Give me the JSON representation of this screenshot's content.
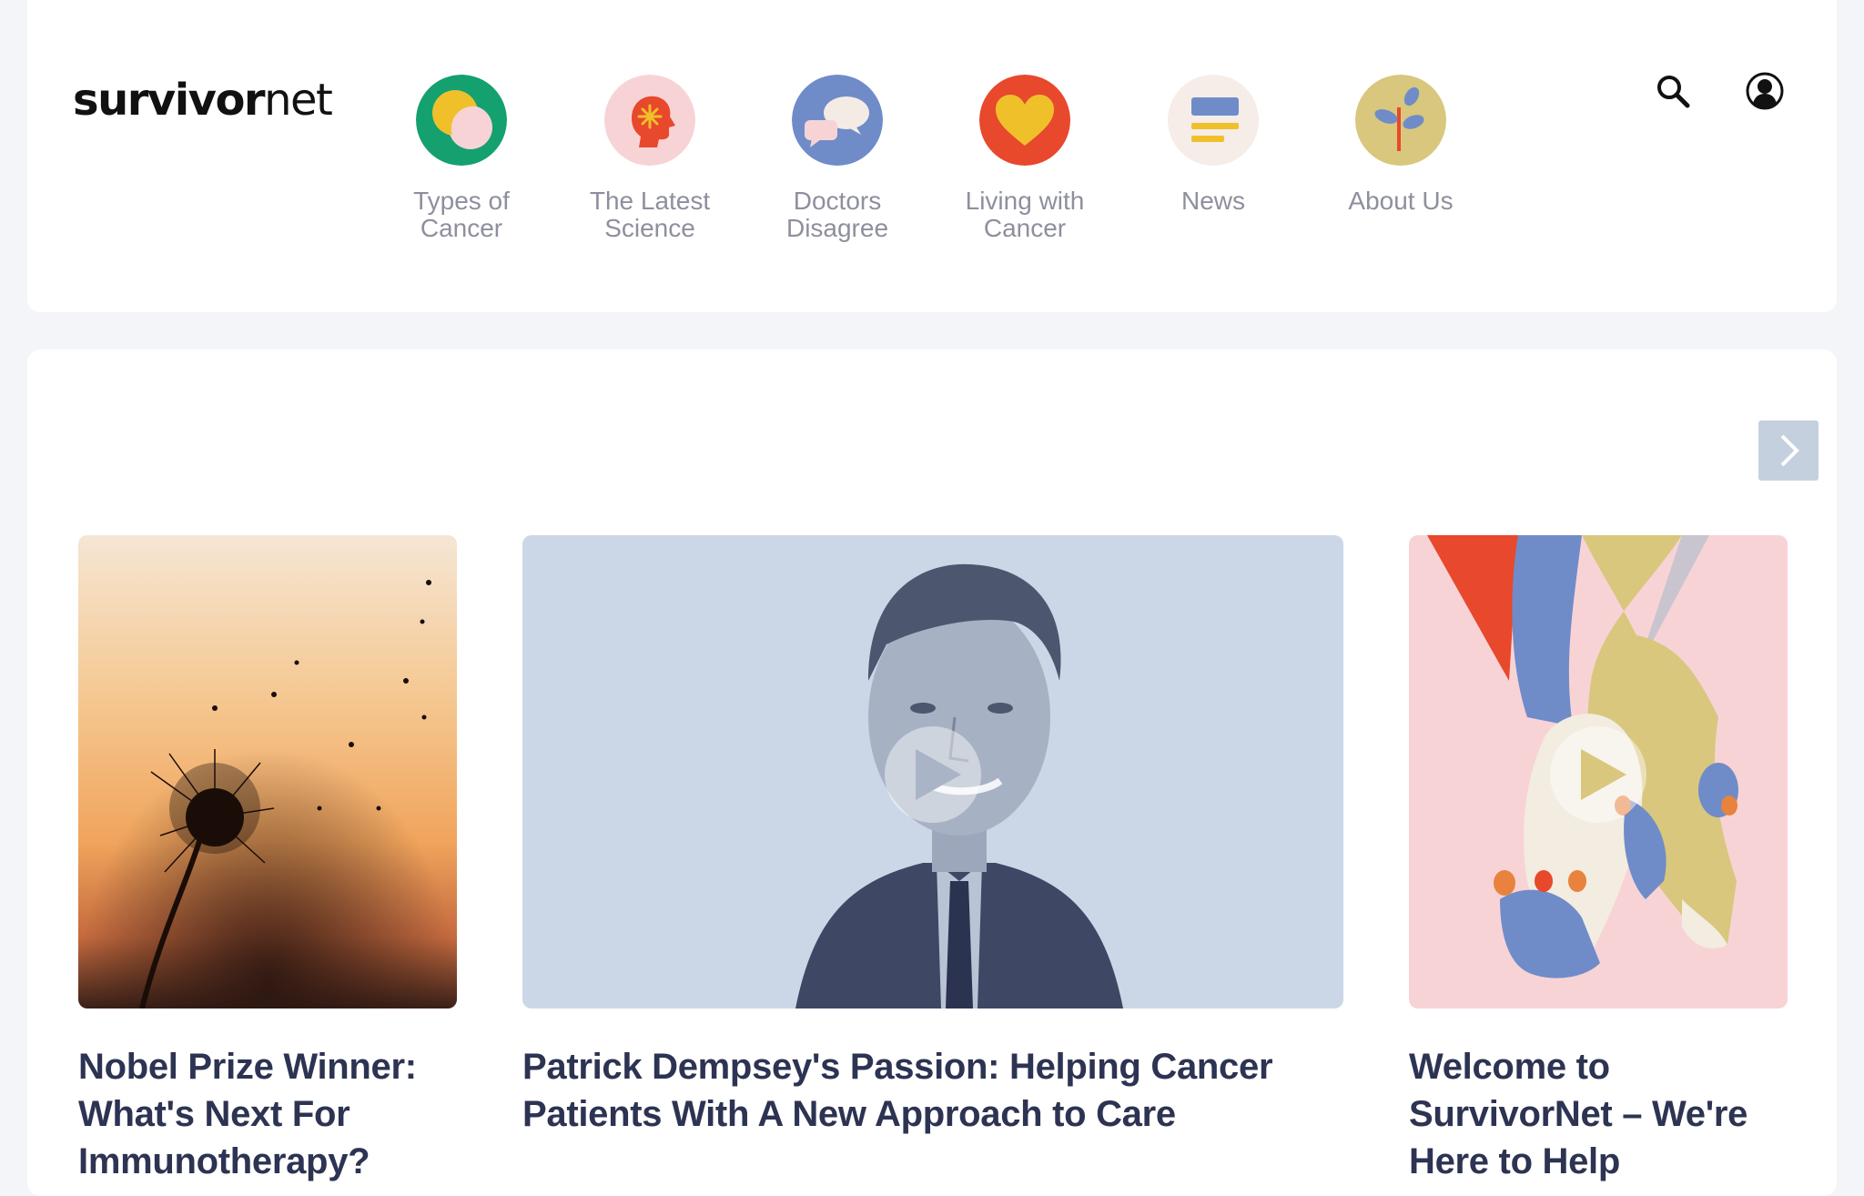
{
  "logo": {
    "bold": "survivor",
    "light": "net"
  },
  "nav": [
    {
      "label": "Types of\nCancer"
    },
    {
      "label": "The Latest\nScience"
    },
    {
      "label": "Doctors\nDisagree"
    },
    {
      "label": "Living with\nCancer"
    },
    {
      "label": "News"
    },
    {
      "label": "About Us"
    }
  ],
  "header_icons": {
    "search": "search-icon",
    "account": "user-account-icon"
  },
  "carousel": {
    "next_icon": "chevron-right-icon",
    "cards": [
      {
        "title": "Nobel Prize Winner: What's Next For Immunotherapy?",
        "has_video": false
      },
      {
        "title": "Patrick Dempsey's Passion: Helping Cancer Patients With A New Approach to Care",
        "has_video": true
      },
      {
        "title": "Welcome to SurvivorNet – We're Here to Help",
        "has_video": true
      }
    ]
  },
  "colors": {
    "background": "#f4f5f9",
    "title_text": "#2d3352",
    "nav_text": "#8e8f9e",
    "next_button": "#c5d0de"
  }
}
